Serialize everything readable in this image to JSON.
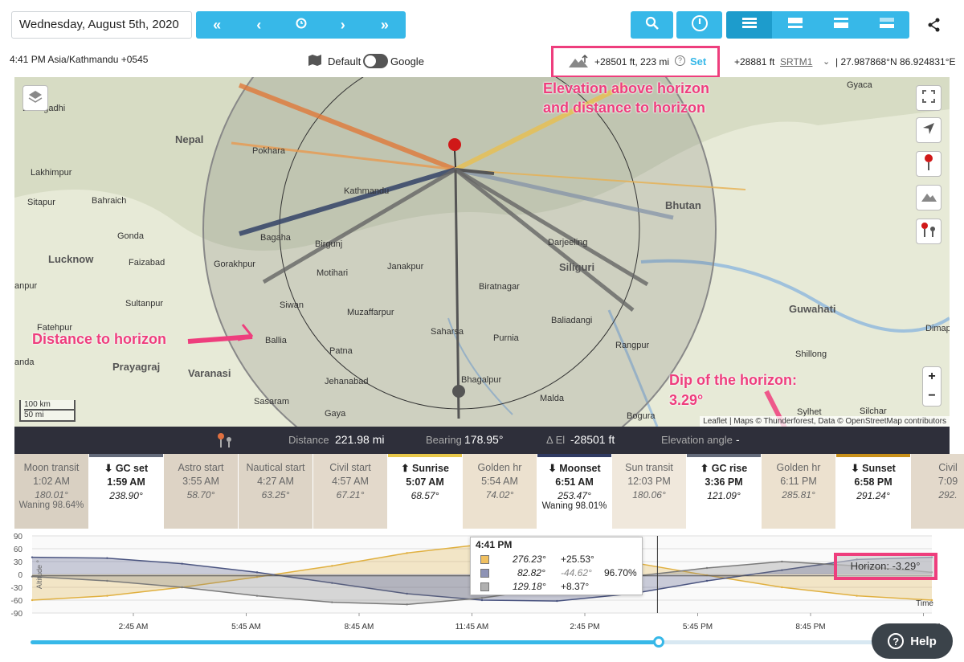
{
  "header": {
    "date": "Wednesday, August 5th, 2020",
    "timezone_line": "4:41 PM Asia/Kathmandu +0545",
    "map_default": "Default",
    "map_google": "Google",
    "elevation_readout": "+28501 ft, 223 mi",
    "set_label": "Set",
    "elev_ft": "+28881 ft",
    "srtm": "SRTM1",
    "coords": "| 27.987868°N 86.924831°E"
  },
  "annotations": {
    "elev_title_1": "Elevation above horizon",
    "elev_title_2": "and distance to horizon",
    "distance_to_horizon": "Distance to horizon",
    "dip_1": "Dip of the horizon:",
    "dip_2": "3.29°"
  },
  "map": {
    "labels": {
      "nepal": "Nepal",
      "bhutan": "Bhutan",
      "dhangadhi": "Dhangadhi",
      "lakhimpur": "Lakhimpur",
      "sitapur": "Sitapur",
      "bahraich": "Bahraich",
      "gonda": "Gonda",
      "lucknow": "Lucknow",
      "faizabad": "Faizabad",
      "gorakhpur": "Gorakhpur",
      "kanpur": "anpur",
      "sultanpur": "Sultanpur",
      "fatehpur": "Fatehpur",
      "prayagraj": "Prayagraj",
      "varanasi": "Varanasi",
      "banda": "anda",
      "pokhara": "Pokhara",
      "kathmandu": "Kathmandu",
      "bagaha": "Bagaha",
      "birgunj": "Birgunj",
      "motihari": "Motihari",
      "janakpur": "Janakpur",
      "siwan": "Siwan",
      "muzaffarpur": "Muzaffarpur",
      "ballia": "Ballia",
      "patna": "Patna",
      "jehanabad": "Jehanabad",
      "sasaram": "Sasaram",
      "gaya": "Gaya",
      "saharsa": "Saharsa",
      "purnia": "Purnia",
      "biratnagar": "Biratnagar",
      "darjeeling": "Darjeeling",
      "siliguri": "Siliguri",
      "baliadangi": "Baliadangi",
      "rangpur": "Rangpur",
      "bhagalpur": "Bhagalpur",
      "malda": "Malda",
      "bogura": "Bogura",
      "guwahati": "Guwahati",
      "shillong": "Shillong",
      "dimapur": "Dimap",
      "gyaca": "Gyaca",
      "silchar": "Silchar",
      "sylhet": "Sylhet"
    },
    "scale_km": "100 km",
    "scale_mi": "50 mi",
    "attribution": "Leaflet | Maps © Thunderforest, Data © OpenStreetMap contributors"
  },
  "infobar": {
    "distance_label": "Distance",
    "distance_value": "221.98 mi",
    "bearing_label": "Bearing",
    "bearing_value": "178.95°",
    "del_label": "Δ El",
    "del_value": "-28501 ft",
    "angle_label": "Elevation angle",
    "angle_value": "-"
  },
  "phases": [
    {
      "name": "Moon transit",
      "time": "1:02 AM",
      "az": "180.01°",
      "extra": "Waning 98.64%",
      "bg": "#d9d0c2",
      "top": ""
    },
    {
      "name": "⬇ GC set",
      "time": "1:59 AM",
      "az": "238.90°",
      "extra": "",
      "bg": "#ffffff",
      "top": "#636a7a",
      "hl": true
    },
    {
      "name": "Astro start",
      "time": "3:55 AM",
      "az": "58.70°",
      "extra": "",
      "bg": "#ddd3c5",
      "top": ""
    },
    {
      "name": "Nautical start",
      "time": "4:27 AM",
      "az": "63.25°",
      "extra": "",
      "bg": "#ddd4c6",
      "top": ""
    },
    {
      "name": "Civil start",
      "time": "4:57 AM",
      "az": "67.21°",
      "extra": "",
      "bg": "#e3d9cb",
      "top": ""
    },
    {
      "name": "⬆ Sunrise",
      "time": "5:07 AM",
      "az": "68.57°",
      "extra": "",
      "bg": "#ffffff",
      "top": "#e8c84a",
      "hl": true
    },
    {
      "name": "Golden hr",
      "time": "5:54 AM",
      "az": "74.02°",
      "extra": "",
      "bg": "#ece1cf",
      "top": ""
    },
    {
      "name": "⬇ Moonset",
      "time": "6:51 AM",
      "az": "253.47°",
      "extra": "Waning 98.01%",
      "bg": "#ffffff",
      "top": "#303b63",
      "hl": true
    },
    {
      "name": "Sun transit",
      "time": "12:03 PM",
      "az": "180.06°",
      "extra": "",
      "bg": "#f0e8dc",
      "top": ""
    },
    {
      "name": "⬆ GC rise",
      "time": "3:36 PM",
      "az": "121.09°",
      "extra": "",
      "bg": "#ffffff",
      "top": "#636a7a",
      "hl": true
    },
    {
      "name": "Golden hr",
      "time": "6:11 PM",
      "az": "285.81°",
      "extra": "",
      "bg": "#ece1cf",
      "top": ""
    },
    {
      "name": "⬇ Sunset",
      "time": "6:58 PM",
      "az": "291.24°",
      "extra": "",
      "bg": "#ffffff",
      "top": "#c8901a",
      "hl": true
    },
    {
      "name": "Civil",
      "time": "7:09",
      "az": "292.",
      "extra": "",
      "bg": "#e3d9cb",
      "top": ""
    }
  ],
  "tooltip": {
    "time": "4:41 PM",
    "rows": [
      {
        "az": "276.23°",
        "alt": "+25.53°",
        "pct": "",
        "color": "#f0c060"
      },
      {
        "az": "82.82°",
        "alt": "-44.62°",
        "pct": "96.70%",
        "color": "#8e93b5"
      },
      {
        "az": "129.18°",
        "alt": "+8.37°",
        "pct": "",
        "color": "#b0b0b0"
      }
    ]
  },
  "chart_data": {
    "type": "area",
    "ylabel": "Altitude °",
    "xlabel": "Time",
    "y_ticks": [
      90,
      60,
      30,
      0,
      -30,
      -60,
      -90
    ],
    "y_ticks_labels": [
      "90",
      "60",
      "30",
      "0",
      "-30",
      "-60",
      "-90"
    ],
    "x_ticks": [
      "2:45 AM",
      "5:45 AM",
      "8:45 AM",
      "11:45 AM",
      "2:45 PM",
      "5:45 PM",
      "8:45 PM",
      "11:45 PM"
    ],
    "ylim": [
      -90,
      90
    ],
    "horizon_label": "Horizon: -3.29°",
    "current_time": "4:41 PM",
    "series": [
      {
        "name": "Sun",
        "color": "#e0b040",
        "x_hours": [
          0,
          2,
          4,
          6,
          8,
          10,
          12,
          14,
          16,
          18,
          20,
          22,
          24
        ],
        "values": [
          -60,
          -50,
          -30,
          -6,
          20,
          50,
          70,
          55,
          28,
          -2,
          -30,
          -50,
          -60
        ]
      },
      {
        "name": "Moon",
        "color": "#4a5480",
        "x_hours": [
          0,
          2,
          4,
          6,
          8,
          10,
          12,
          14,
          16,
          18,
          20,
          22,
          24
        ],
        "values": [
          40,
          38,
          25,
          5,
          -20,
          -45,
          -60,
          -62,
          -45,
          -15,
          10,
          35,
          40
        ]
      },
      {
        "name": "Galactic center",
        "color": "#7a7a7a",
        "x_hours": [
          0,
          2,
          4,
          6,
          8,
          10,
          12,
          14,
          16,
          18,
          20,
          22,
          24
        ],
        "values": [
          -5,
          -15,
          -30,
          -50,
          -65,
          -70,
          -55,
          -30,
          -5,
          15,
          30,
          20,
          5
        ]
      }
    ]
  },
  "help": {
    "label": "Help"
  }
}
